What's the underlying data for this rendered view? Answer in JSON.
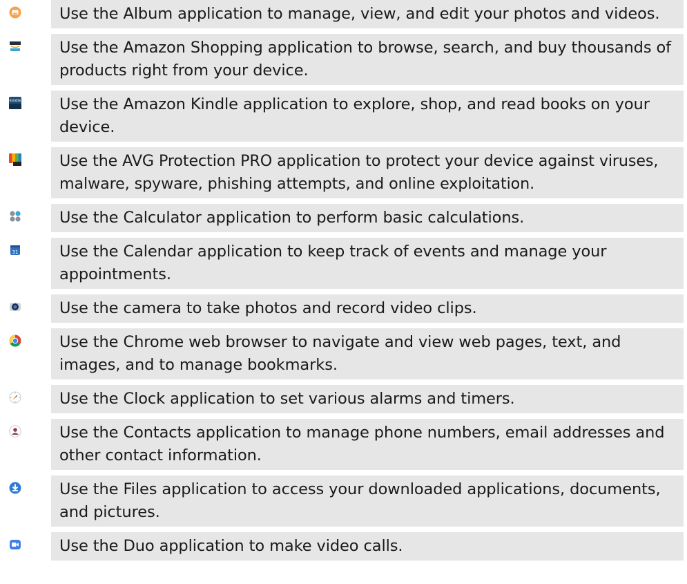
{
  "apps": [
    {
      "icon": "album-icon",
      "description": "Use the Album application to manage, view, and edit your photos and videos."
    },
    {
      "icon": "amazon-shopping-icon",
      "description": "Use the Amazon Shopping application to browse, search, and buy thousands of products right from your device."
    },
    {
      "icon": "amazon-kindle-icon",
      "description": "Use the Amazon Kindle application to explore, shop, and read books on your device.",
      "icon_text": "kindle"
    },
    {
      "icon": "avg-protection-icon",
      "description": "Use the AVG Protection PRO application to protect your device against viruses, malware, spyware, phishing attempts, and online exploitation."
    },
    {
      "icon": "calculator-icon",
      "description": "Use the Calculator application to perform basic calculations."
    },
    {
      "icon": "calendar-icon",
      "description": "Use the Calendar application to keep track of events and manage your appointments.",
      "icon_text": "31"
    },
    {
      "icon": "camera-icon",
      "description": "Use the camera to take photos and record video clips."
    },
    {
      "icon": "chrome-icon",
      "description": "Use the Chrome web browser to navigate and view web pages, text, and images, and to manage bookmarks."
    },
    {
      "icon": "clock-icon",
      "description": "Use the Clock application to set various alarms and timers."
    },
    {
      "icon": "contacts-icon",
      "description": "Use the Contacts application to manage phone numbers, email addresses and other contact information."
    },
    {
      "icon": "files-icon",
      "description": "Use the Files application to access your downloaded applications, documents, and pictures."
    },
    {
      "icon": "duo-icon",
      "description": "Use the Duo application to make video calls."
    }
  ]
}
